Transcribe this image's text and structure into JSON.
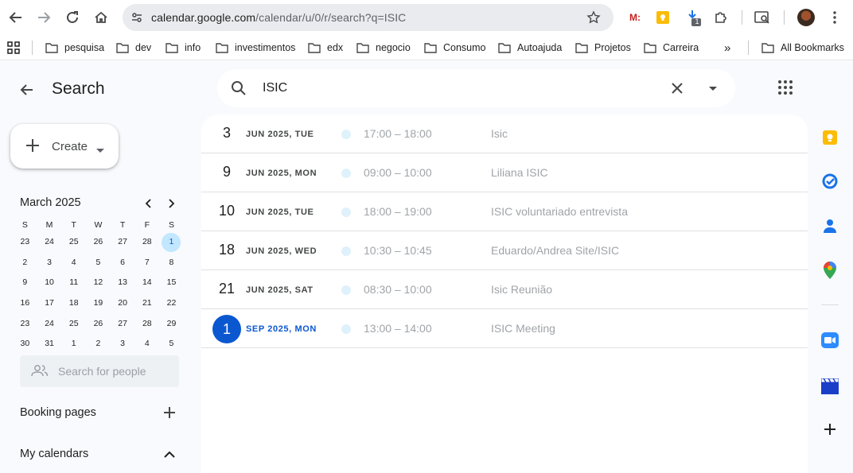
{
  "browser": {
    "url_host": "calendar.google.com",
    "url_path": "/calendar/u/0/r/search?q=ISIC",
    "extension_badge": "1",
    "extension_m_label": "M:"
  },
  "bookmarks": {
    "items": [
      {
        "label": "pesquisa"
      },
      {
        "label": "dev"
      },
      {
        "label": "info"
      },
      {
        "label": "investimentos"
      },
      {
        "label": "edx"
      },
      {
        "label": "negocio"
      },
      {
        "label": "Consumo"
      },
      {
        "label": "Autoajuda"
      },
      {
        "label": "Projetos"
      },
      {
        "label": "Carreira"
      }
    ],
    "overflow": "»",
    "all_bookmarks": "All Bookmarks"
  },
  "header": {
    "title": "Search"
  },
  "create": {
    "label": "Create"
  },
  "mini_calendar": {
    "month_label": "March 2025",
    "weekdays": [
      "S",
      "M",
      "T",
      "W",
      "T",
      "F",
      "S"
    ],
    "weeks": [
      [
        "23",
        "24",
        "25",
        "26",
        "27",
        "28",
        "1"
      ],
      [
        "2",
        "3",
        "4",
        "5",
        "6",
        "7",
        "8"
      ],
      [
        "9",
        "10",
        "11",
        "12",
        "13",
        "14",
        "15"
      ],
      [
        "16",
        "17",
        "18",
        "19",
        "20",
        "21",
        "22"
      ],
      [
        "23",
        "24",
        "25",
        "26",
        "27",
        "28",
        "29"
      ],
      [
        "30",
        "31",
        "1",
        "2",
        "3",
        "4",
        "5"
      ]
    ]
  },
  "people_search": {
    "placeholder": "Search for people"
  },
  "sidebar": {
    "booking_pages": "Booking pages",
    "my_calendars": "My calendars"
  },
  "search": {
    "query": "ISIC"
  },
  "results": [
    {
      "day": "3",
      "date": "JUN 2025, TUE",
      "time": "17:00 – 18:00",
      "title": "Isic",
      "current": false
    },
    {
      "day": "9",
      "date": "JUN 2025, MON",
      "time": "09:00 – 10:00",
      "title": "Liliana ISIC",
      "current": false
    },
    {
      "day": "10",
      "date": "JUN 2025, TUE",
      "time": "18:00 – 19:00",
      "title": "ISIC voluntariado entrevista",
      "current": false
    },
    {
      "day": "18",
      "date": "JUN 2025, WED",
      "time": "10:30 – 10:45",
      "title": "Eduardo/Andrea Site/ISIC",
      "current": false
    },
    {
      "day": "21",
      "date": "JUN 2025, SAT",
      "time": "08:30 – 10:00",
      "title": "Isic Reunião",
      "current": false
    },
    {
      "day": "1",
      "date": "SEP 2025, MON",
      "time": "13:00 – 14:00",
      "title": "ISIC Meeting",
      "current": true
    }
  ],
  "colors": {
    "accent": "#0b57d0",
    "today_bg": "#c2e7ff",
    "event_dot": "#dff1fb"
  }
}
